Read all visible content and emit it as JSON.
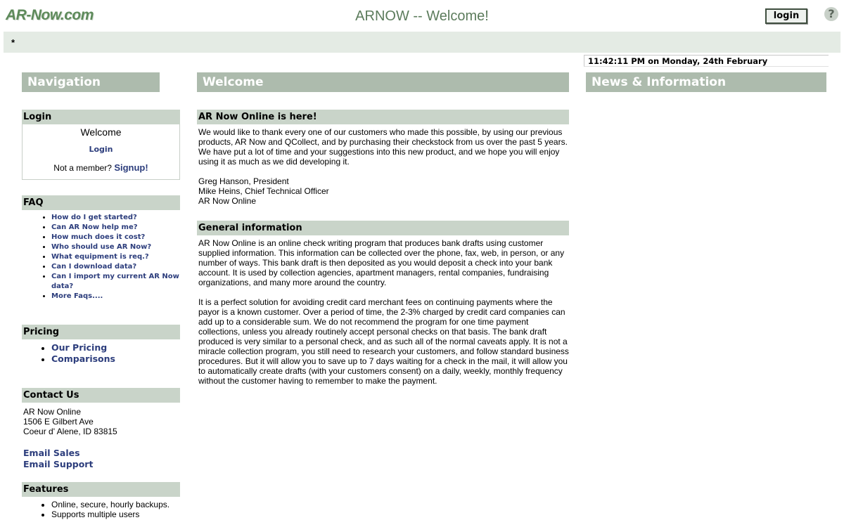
{
  "header": {
    "logo": "AR-Now.com",
    "title": "ARNOW -- Welcome!",
    "login_button": "login",
    "help_icon": "?"
  },
  "menubar": {
    "marker": "*"
  },
  "clock": "11:42:11 PM on Monday, 24th February",
  "columns": {
    "navigation": "Navigation",
    "welcome": "Welcome",
    "news": "News & Information"
  },
  "login": {
    "header": "Login",
    "welcome": "Welcome",
    "login_link": "Login",
    "member_prefix": "Not a member? ",
    "signup_link": "Signup!"
  },
  "faq": {
    "header": "FAQ",
    "items": [
      "How do I get started?",
      "Can AR Now help me?",
      "How much does it cost?",
      "Who should use AR Now?",
      "What equipment is req.?",
      "Can I download data?",
      "Can I import my current AR Now data?",
      "More Faqs...."
    ]
  },
  "pricing": {
    "header": "Pricing",
    "items": [
      "Our Pricing",
      "Comparisons"
    ]
  },
  "contact": {
    "header": "Contact Us",
    "line1": "AR Now Online",
    "line2": "1506 E Gilbert Ave",
    "line3": "Coeur d' Alene, ID 83815",
    "email_sales": "Email Sales",
    "email_support": "Email Support"
  },
  "features": {
    "header": "Features",
    "items": [
      "Online, secure, hourly backups.",
      "Supports multiple users"
    ]
  },
  "main": {
    "section1_header": "AR Now Online is here!",
    "section1_para1": "We would like to thank every one of our customers who made this possible, by using our previous products, AR Now and QCollect, and by purchasing their checkstock from us over the past 5 years.  We have put a lot of time and your suggestions into this new product, and we hope you will enjoy using it as much as we did developing it.",
    "signature_line1": "Greg Hanson, President",
    "signature_line2": "Mike Heins, Chief Technical Officer",
    "signature_line3": "AR Now Online",
    "section2_header": "General information",
    "section2_para1": "AR Now Online is an online check writing program that produces bank drafts using customer supplied information. This information can be collected over the phone, fax, web, in person, or any number of ways. This bank draft is then deposited as you would deposit a check into your bank account. It is used by collection agencies, apartment managers, rental companies, fundraising organizations, and many more around the country.",
    "section2_para2": "It is a perfect solution for avoiding credit card merchant fees on continuing payments where the payor is a known customer. Over a period of time, the 2-3% charged by credit card companies can add up to a considerable sum. We do not recommend the program for one time payment collections, unless you already routinely accept personal checks on that basis. The bank draft produced is very similar to a personal check, and as such all of the normal caveats apply. It is not a miracle collection program, you still need to research your customers, and follow standard business procedures. But it will allow you to save up to 7 days waiting for a check in the mail, it will allow you to automatically create drafts (with your customers consent) on a daily, weekly, monthly frequency without the customer having to remember to make the payment."
  }
}
